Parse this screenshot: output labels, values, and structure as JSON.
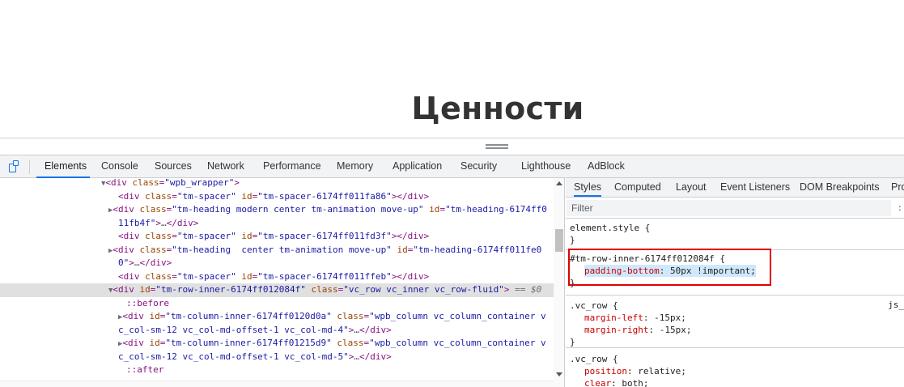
{
  "page": {
    "heading": "Ценности"
  },
  "devtools": {
    "tabs": [
      "Elements",
      "Console",
      "Sources",
      "Network",
      "Performance",
      "Memory",
      "Application",
      "Security",
      "Lighthouse",
      "AdBlock"
    ],
    "active_tab": "Elements",
    "accent_color": "#1a73e8"
  },
  "elements": {
    "lines": [
      {
        "text_tag_open": "<div",
        "attrs": [
          [
            "class",
            "\"wpb_wrapper\""
          ]
        ],
        "tail": ">"
      },
      {
        "text": "<div class=\"tm-spacer\" id=\"tm-spacer-6174ff011fa86\"></div>"
      },
      {
        "text": "<div class=\"tm-heading modern center tm-animation move-up\" id=\"tm-heading-6174ff0"
      },
      {
        "text": "11fb4f\">…</div>"
      },
      {
        "text": "<div class=\"tm-spacer\" id=\"tm-spacer-6174ff011fd3f\"></div>"
      },
      {
        "text": "<div class=\"tm-heading  center tm-animation move-up\" id=\"tm-heading-6174ff011fe0"
      },
      {
        "text": "0\">…</div>"
      },
      {
        "text": "<div class=\"tm-spacer\" id=\"tm-spacer-6174ff011ffeb\"></div>"
      },
      {
        "text": "<div id=\"tm-row-inner-6174ff012084f\" class=\"vc_row vc_inner vc_row-fluid\"> == $0"
      },
      {
        "text": "::before"
      },
      {
        "text": "<div id=\"tm-column-inner-6174ff0120d0a\" class=\"wpb_column vc_column_container v"
      },
      {
        "text": "c_col-sm-12 vc_col-md-offset-1 vc_col-md-4\">…</div>"
      },
      {
        "text": "<div id=\"tm-column-inner-6174ff01215d9\" class=\"wpb_column vc_column_container v"
      },
      {
        "text": "c_col-sm-12 vc_col-md-offset-1 vc_col-md-5\">…</div>"
      },
      {
        "text": "::after"
      }
    ],
    "selected_marker": "== $0"
  },
  "styles_pane": {
    "tabs": [
      "Styles",
      "Computed",
      "Layout",
      "Event Listeners",
      "DOM Breakpoints",
      "Pro"
    ],
    "active_tab": "Styles",
    "filter_placeholder": "Filter",
    "filter_more": ":",
    "rules": [
      {
        "selector": "element.style {",
        "close": "}",
        "props": []
      },
      {
        "selector": "#tm-row-inner-6174ff012084f {",
        "close": "}",
        "props": [
          {
            "name": "padding-bottom",
            "value": "50px !important;"
          }
        ]
      },
      {
        "selector": ".vc_row {",
        "close": "}",
        "source": "js_",
        "props": [
          {
            "name": "margin-left",
            "value": "-15px;"
          },
          {
            "name": "margin-right",
            "value": "-15px;"
          }
        ]
      },
      {
        "selector": ".vc_row {",
        "props": [
          {
            "name": "position",
            "value": "relative;"
          },
          {
            "name": "clear",
            "value": "both;"
          }
        ]
      }
    ],
    "highlight_color": "#e00000"
  }
}
